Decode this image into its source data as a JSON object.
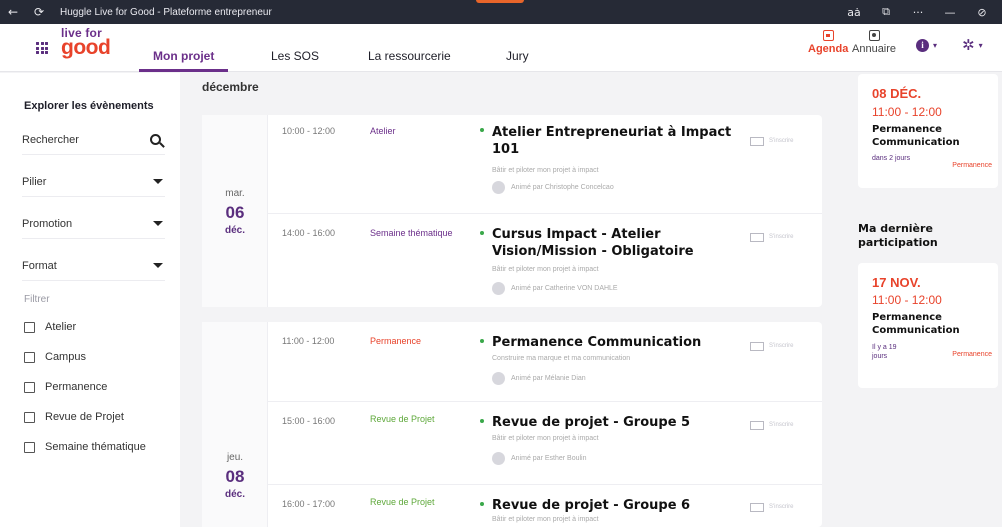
{
  "window": {
    "title": "Huggle Live for Good - Plateforme entrepreneur",
    "back_glyph": "←",
    "reload_glyph": "⟳",
    "right_icons": [
      "aȧ",
      "⧉",
      "···",
      "—",
      "⊘"
    ]
  },
  "header": {
    "logo_line1": "live for",
    "logo_line2": "good",
    "tabs": [
      {
        "label": "Mon projet",
        "active": true
      },
      {
        "label": "Les SOS"
      },
      {
        "label": "La ressourcerie"
      },
      {
        "label": "Jury"
      }
    ],
    "agenda_label": "Agenda",
    "annuaire_label": "Annuaire",
    "info_glyph": "i",
    "settings_glyph": "✲",
    "caret_glyph": "▾"
  },
  "sidebar": {
    "title": "Explorer les évènements",
    "search_placeholder": "Rechercher",
    "dropdowns": [
      "Pilier",
      "Promotion",
      "Format"
    ],
    "filter_label": "Filtrer",
    "filters": [
      "Atelier",
      "Campus",
      "Permanence",
      "Revue de Projet",
      "Semaine thématique"
    ]
  },
  "main": {
    "month": "décembre",
    "days": [
      {
        "dow": "mar.",
        "num": "06",
        "mon": "déc.",
        "events": [
          {
            "time": "10:00 - 12:00",
            "type": "Atelier",
            "type_color": "#6b2f8a",
            "title": "Atelier Entrepreneuriat à Impact 101",
            "subtitle": "Bâtir et piloter mon projet à impact",
            "animator": "Animé par Christophe Concelcao",
            "check_label": "S'inscrire"
          },
          {
            "time": "14:00 - 16:00",
            "type": "Semaine thématique",
            "type_color": "#6b2f8a",
            "title": "Cursus Impact - Atelier Vision/Mission - Obligatoire",
            "subtitle": "Bâtir et piloter mon projet à impact",
            "animator": "Animé par Catherine VON DAHLE",
            "check_label": "S'inscrire"
          }
        ]
      },
      {
        "dow": "jeu.",
        "num": "08",
        "mon": "déc.",
        "events": [
          {
            "time": "11:00 - 12:00",
            "type": "Permanence",
            "type_color": "#e8432b",
            "title": "Permanence Communication",
            "subtitle": "Construire ma marque et ma communication",
            "animator": "Animé par Mélanie Dian",
            "check_label": "S'inscrire"
          },
          {
            "time": "15:00 - 16:00",
            "type": "Revue de Projet",
            "type_color": "#5ea83a",
            "title": "Revue de projet - Groupe 5",
            "subtitle": "Bâtir et piloter mon projet à impact",
            "animator": "Animé par Esther Boulin",
            "check_label": "S'inscrire"
          },
          {
            "time": "16:00 - 17:00",
            "type": "Revue de Projet",
            "type_color": "#5ea83a",
            "title": "Revue de projet - Groupe 6",
            "subtitle": "Bâtir et piloter mon projet à impact",
            "animator": "",
            "check_label": "S'inscrire"
          }
        ]
      }
    ]
  },
  "right_panel": {
    "next_event": {
      "date": "08 DÉC.",
      "time": "11:00 - 12:00",
      "title": "Permanence Communication",
      "relative": "dans 2 jours",
      "type": "Permanence"
    },
    "last_heading": "Ma dernière participation",
    "last_event": {
      "date": "17 NOV.",
      "time": "11:00 - 12:00",
      "title": "Permanence Communication",
      "relative": "Il y a 19 jours",
      "type": "Permanence"
    }
  },
  "colors": {
    "accent_purple": "#6b2f8a",
    "accent_red": "#e8432b",
    "green": "#5ea83a",
    "titlebar": "#262a36"
  }
}
